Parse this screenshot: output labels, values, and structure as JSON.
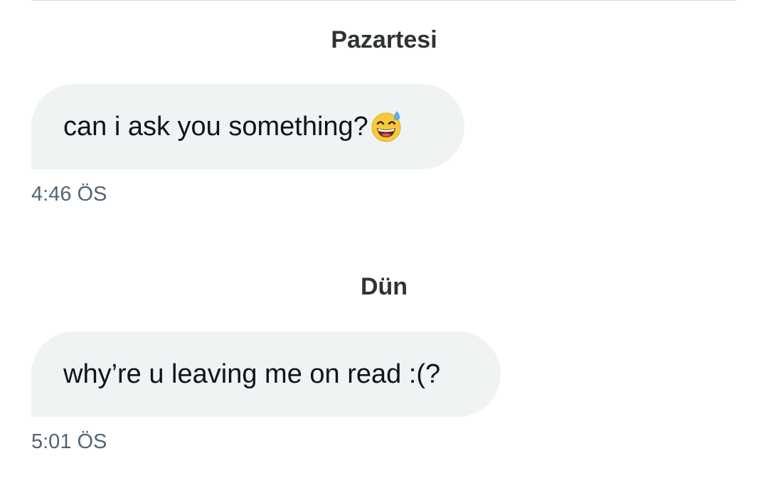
{
  "conversation": {
    "day_separators": [
      "Pazartesi",
      "Dün"
    ],
    "messages": [
      {
        "text": "can i ask you something?",
        "emoji": "grinning-face-with-sweat-icon",
        "time": "4:46 ÖS"
      },
      {
        "text": "why’re u leaving me on read :(?",
        "time": "5:01 ÖS"
      }
    ]
  },
  "colors": {
    "bubble_bg": "#eff3f4",
    "timestamp": "#536471",
    "divider": "#cfd9de",
    "text": "#0f1419"
  }
}
